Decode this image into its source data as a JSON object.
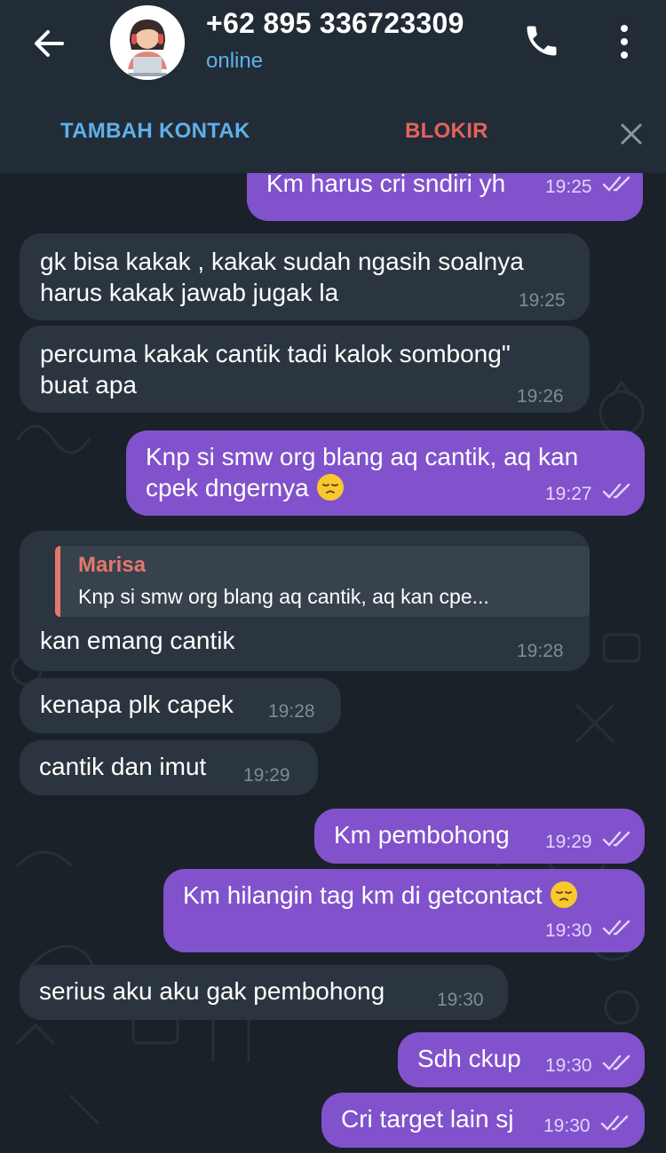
{
  "header": {
    "contact_name": "+62 895 336723309",
    "status": "online",
    "add_contact_label": "TAMBAH KONTAK",
    "block_label": "BLOKIR",
    "icons": {
      "back": "arrow-left-icon",
      "call": "phone-icon",
      "menu": "more-vertical-icon",
      "close": "close-icon"
    }
  },
  "colors": {
    "background": "#1a2129",
    "header": "#222c36",
    "incoming_bubble": "#2b353f",
    "outgoing_bubble": "#8152cc",
    "link_blue": "#5fb0ea",
    "block_red": "#e4625f",
    "reply_accent": "#e4786d"
  },
  "messages": [
    {
      "direction": "out",
      "text": "Km harus cri sndiri yh",
      "time": "19:25",
      "read": true
    },
    {
      "direction": "in",
      "lines": [
        "gk bisa kakak , kakak sudah ngasih soalnya",
        "harus kakak jawab jugak la"
      ],
      "time": "19:25"
    },
    {
      "direction": "in",
      "lines": [
        "percuma kakak cantik tadi kalok sombong\"",
        "buat apa"
      ],
      "time": "19:26"
    },
    {
      "direction": "out",
      "lines": [
        "Knp si smw org blang aq cantik, aq kan",
        "cpek dngernya"
      ],
      "emoji": "pensive-face-emoji",
      "time": "19:27",
      "read": true
    },
    {
      "direction": "in",
      "reply_to": {
        "name": "Marisa",
        "text": "Knp si smw org blang aq cantik, aq kan cpe..."
      },
      "text": "kan emang cantik",
      "time": "19:28"
    },
    {
      "direction": "in",
      "text": "kenapa plk capek",
      "time": "19:28"
    },
    {
      "direction": "in",
      "text": "cantik dan imut",
      "time": "19:29"
    },
    {
      "direction": "out",
      "text": "Km pembohong",
      "time": "19:29",
      "read": true
    },
    {
      "direction": "out",
      "text": "Km hilangin tag km di getcontact",
      "emoji": "pensive-face-emoji",
      "time": "19:30",
      "read": true
    },
    {
      "direction": "in",
      "text": "serius aku aku gak pembohong",
      "time": "19:30"
    },
    {
      "direction": "out",
      "text": "Sdh ckup",
      "time": "19:30",
      "read": true
    },
    {
      "direction": "out",
      "text": "Cri target lain sj",
      "time": "19:30",
      "read": true
    }
  ]
}
